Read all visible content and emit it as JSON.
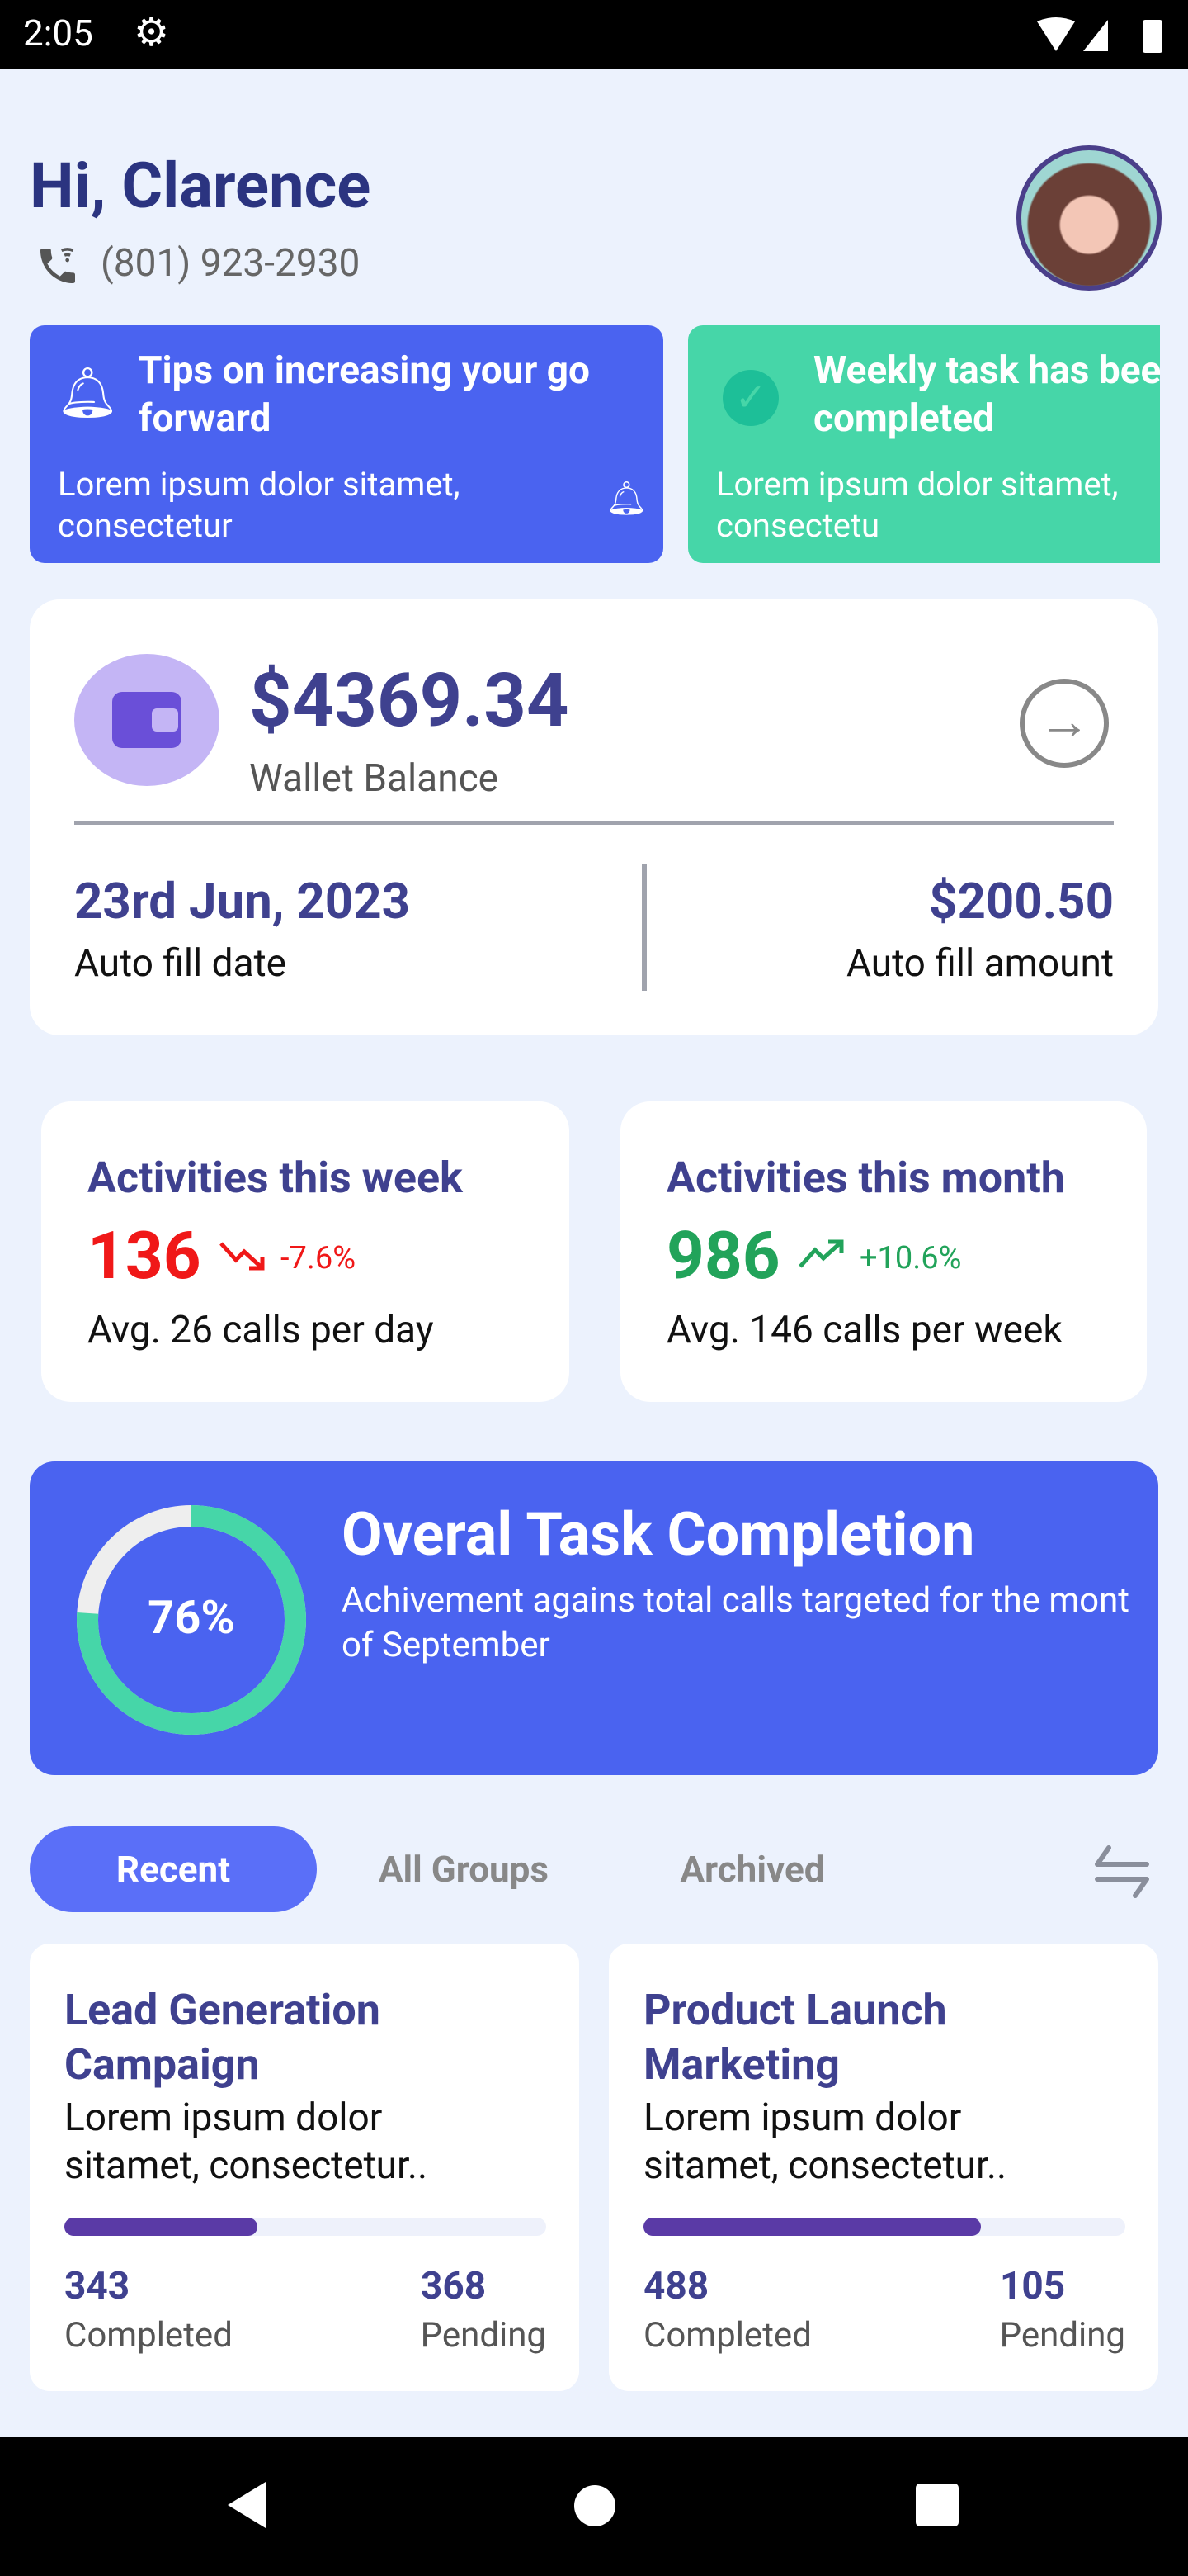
{
  "status_bar": {
    "time": "2:05"
  },
  "header": {
    "greeting": "Hi, Clarence",
    "phone": "(801) 923-2930"
  },
  "notifications": [
    {
      "title": "Tips on increasing your go forward",
      "body": "Lorem ipsum dolor sitamet, consectetur",
      "color": "#4a63f0"
    },
    {
      "title": "Weekly task has been completed",
      "body": "Lorem ipsum dolor sitamet, consectetu",
      "color": "#46d6a8"
    }
  ],
  "wallet": {
    "amount": "$4369.34",
    "label": "Wallet Balance",
    "date": "23rd Jun, 2023",
    "date_label": "Auto fill date",
    "fill_amount": "$200.50",
    "fill_label": "Auto fill amount"
  },
  "activities": [
    {
      "title": "Activities this week",
      "value": "136",
      "change": "-7.6%",
      "trend": "down",
      "avg": "Avg. 26 calls per day",
      "color": "#f01818"
    },
    {
      "title": "Activities this month",
      "value": "986",
      "change": "+10.6%",
      "trend": "up",
      "avg": "Avg. 146 calls per week",
      "color": "#22a35a"
    }
  ],
  "completion": {
    "percent_label": "76%",
    "percent": 76,
    "title": "Overal Task Completion",
    "subtitle": "Achivement agains total calls targeted for the mont of September"
  },
  "tabs": [
    "Recent",
    "All Groups",
    "Archived"
  ],
  "groups": [
    {
      "title": "Lead Generation Campaign",
      "desc": "Lorem ipsum dolor sitamet, consectetur..",
      "progress": 0.4,
      "completed": "343",
      "completed_label": "Completed",
      "pending": "368",
      "pending_label": "Pending"
    },
    {
      "title": "Product Launch Marketing",
      "desc": "Lorem ipsum dolor sitamet, consectetur..",
      "progress": 0.7,
      "completed": "488",
      "completed_label": "Completed",
      "pending": "105",
      "pending_label": "Pending"
    }
  ]
}
